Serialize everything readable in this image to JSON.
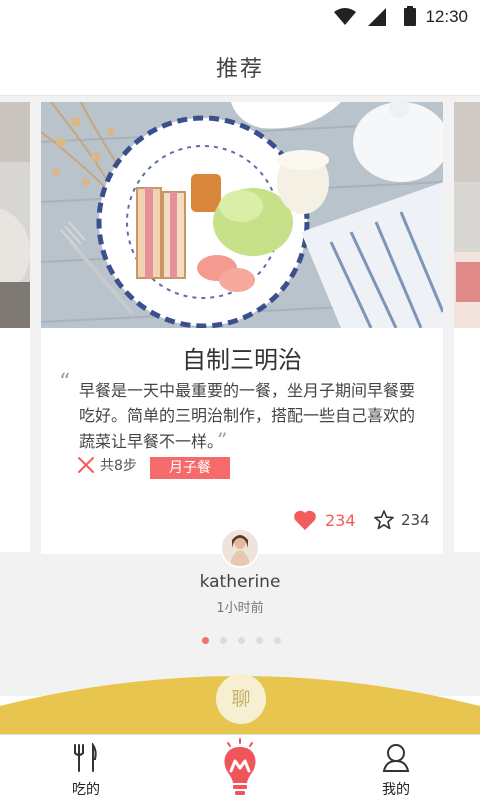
{
  "status_bar": {
    "time": "12:30",
    "icons": [
      "wifi-icon",
      "signal-icon",
      "battery-icon"
    ]
  },
  "header": {
    "title": "推荐"
  },
  "card": {
    "title": "自制三明治",
    "description": "早餐是一天中最重要的一餐，坐月子期间早餐要吃好。简单的三明治制作，搭配一些自己喜欢的蔬菜让早餐不一样。",
    "quote_open": "“",
    "quote_close": "”",
    "steps": "共8步",
    "tag": "月子餐",
    "likes": "234",
    "favorites": "234"
  },
  "author": {
    "name": "katherine",
    "time": "1小时前"
  },
  "pagination": {
    "total": 5,
    "active": 1
  },
  "chat_button": {
    "label": "聊"
  },
  "tabs": [
    {
      "label": "吃的",
      "icon": "fork-knife-icon"
    },
    {
      "label": "",
      "icon": "lightbulb-logo-icon"
    },
    {
      "label": "我的",
      "icon": "user-icon"
    }
  ],
  "colors": {
    "accent": "#f56b6b",
    "chat_wave": "#e8c54e",
    "background": "#f2f2f2"
  }
}
